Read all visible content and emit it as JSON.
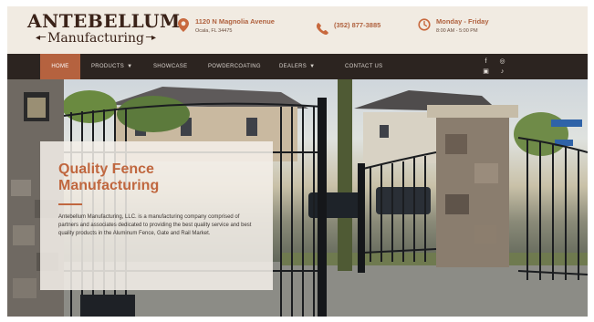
{
  "brand": {
    "name_top": "ANTEBELLUM",
    "name_bottom": "Manufacturing"
  },
  "contact": {
    "address_line1": "1120 N Magnolia Avenue",
    "address_line2": "Ocala, FL 34475",
    "phone": "(352) 877-3885",
    "hours_title": "Monday - Friday",
    "hours_time": "8:00 AM - 5:00 PM"
  },
  "nav": {
    "items": [
      {
        "label": "Home",
        "dropdown": false
      },
      {
        "label": "Products",
        "dropdown": true
      },
      {
        "label": "Showcase",
        "dropdown": false
      },
      {
        "label": "Powdercoating",
        "dropdown": false
      },
      {
        "label": "Dealers",
        "dropdown": true
      },
      {
        "label": "Contact Us",
        "dropdown": false
      }
    ],
    "social": [
      "f",
      "◎",
      "▣",
      "♪"
    ]
  },
  "hero": {
    "title": "Quality Fence Manufacturing",
    "body": "Antebellum Manufacturing, LLC. is a manufacturing company comprised of partners and associates dedicated to providing the best quality service and best quality products in the Aluminum Fence, Gate and Rail Market."
  },
  "colors": {
    "accent": "#b5623f",
    "nav_bg": "#2c2420",
    "header_bg": "#f1ebe2"
  }
}
